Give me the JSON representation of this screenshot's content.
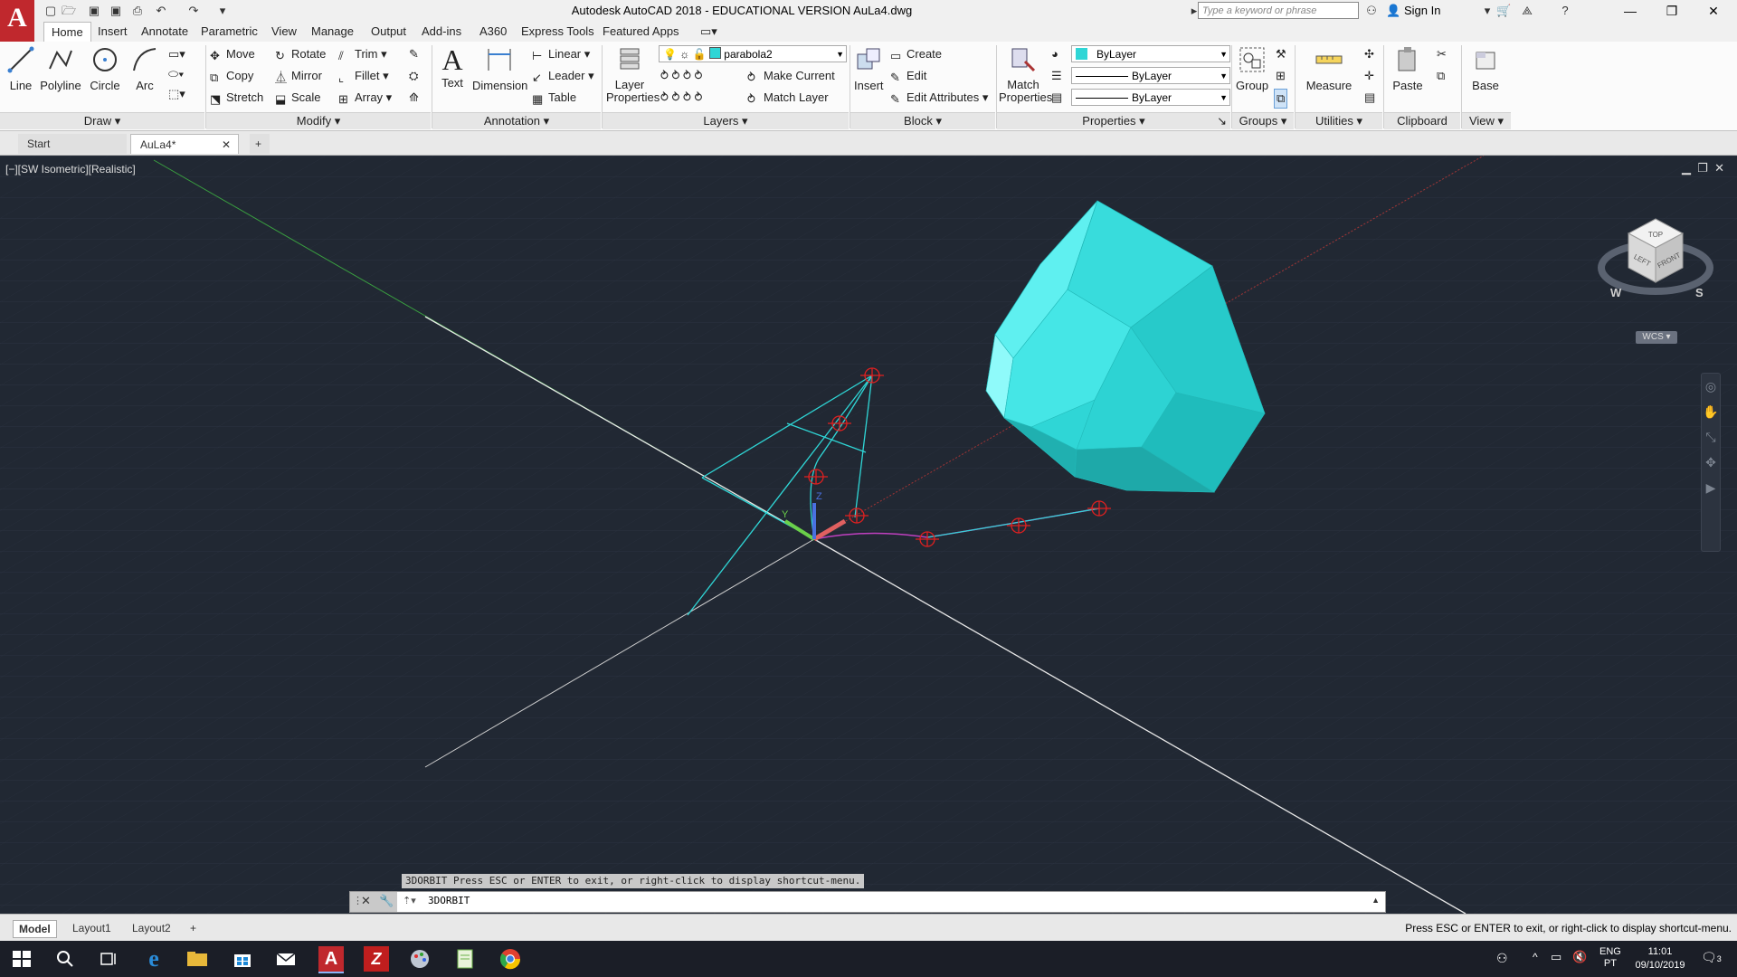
{
  "title": "Autodesk AutoCAD 2018 - EDUCATIONAL VERSION    AuLa4.dwg",
  "search_placeholder": "Type a keyword or phrase",
  "signin": "Sign In",
  "ribbon_tabs": [
    "Home",
    "Insert",
    "Annotate",
    "Parametric",
    "View",
    "Manage",
    "Output",
    "Add-ins",
    "A360",
    "Express Tools",
    "Featured Apps"
  ],
  "draw": {
    "line": "Line",
    "polyline": "Polyline",
    "circle": "Circle",
    "arc": "Arc",
    "footer": "Draw"
  },
  "modify": {
    "move": "Move",
    "rotate": "Rotate",
    "trim": "Trim",
    "copy": "Copy",
    "mirror": "Mirror",
    "fillet": "Fillet",
    "stretch": "Stretch",
    "scale": "Scale",
    "array": "Array",
    "footer": "Modify"
  },
  "annotation": {
    "text": "Text",
    "dimension": "Dimension",
    "linear": "Linear",
    "leader": "Leader",
    "table": "Table",
    "footer": "Annotation"
  },
  "layers": {
    "layer_properties_1": "Layer",
    "layer_properties_2": "Properties",
    "current_layer": "parabola2",
    "make_current": "Make Current",
    "match_layer": "Match Layer",
    "footer": "Layers"
  },
  "block": {
    "insert": "Insert",
    "create": "Create",
    "edit": "Edit",
    "edit_attributes": "Edit Attributes",
    "footer": "Block"
  },
  "properties": {
    "match_1": "Match",
    "match_2": "Properties",
    "color": "ByLayer",
    "linetype": "ByLayer",
    "lineweight": "ByLayer",
    "footer": "Properties"
  },
  "groups": {
    "group": "Group",
    "footer": "Groups"
  },
  "utilities": {
    "measure": "Measure",
    "footer": "Utilities"
  },
  "clipboard": {
    "paste": "Paste",
    "footer": "Clipboard"
  },
  "view": {
    "base": "Base",
    "footer": "View"
  },
  "doc_tabs": {
    "start": "Start",
    "active": "AuLa4*"
  },
  "viewport": {
    "label": "[−][SW Isometric][Realistic]",
    "wcs": "WCS",
    "cube_top": "TOP",
    "cube_left": "LEFT",
    "cube_front": "FRONT",
    "compass_w": "W",
    "compass_s": "S"
  },
  "command": {
    "history": "3DORBIT Press ESC or ENTER to exit, or right-click to display shortcut-menu.",
    "input": "3DORBIT"
  },
  "layout_tabs": [
    "Model",
    "Layout1",
    "Layout2"
  ],
  "status_msg": "Press ESC or ENTER to exit, or right-click to display shortcut-menu.",
  "taskbar": {
    "lang_1": "ENG",
    "lang_2": "PT",
    "time": "11:01",
    "date": "09/10/2019",
    "notif": "3"
  },
  "colors": {
    "surface": "#2fd6d6",
    "accent_red": "#c0282d",
    "grip": "#e02020"
  }
}
